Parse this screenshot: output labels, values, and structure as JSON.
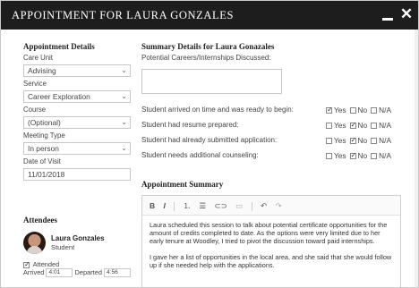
{
  "window": {
    "title": "APPOINTMENT FOR LAURA GONZALES"
  },
  "details": {
    "heading": "Appointment Details",
    "care_unit": {
      "label": "Care Unit",
      "value": "Advising"
    },
    "service": {
      "label": "Service",
      "value": "Career Exploration"
    },
    "course": {
      "label": "Course",
      "value": "(Optional)"
    },
    "meeting_type": {
      "label": "Meeting Type",
      "value": "In person"
    },
    "date": {
      "label": "Date of Visit",
      "value": "11/01/2018"
    }
  },
  "attendees": {
    "heading": "Attendees",
    "name": "Laura Gonzales",
    "role": "Student",
    "attended_label": "Attended",
    "attended": true,
    "arrived_label": "Arrived",
    "arrived": "4:01",
    "departed_label": "Departed",
    "departed": "4:56"
  },
  "summary": {
    "heading": "Summary Details for Laura Gonazales",
    "careers_label": "Potential Careers/Internships Discussed:",
    "questions": [
      {
        "text": "Student arrived on time and was ready to begin:",
        "answer": "Yes"
      },
      {
        "text": "Student had resume prepared:",
        "answer": "No"
      },
      {
        "text": "Student had already submitted application:",
        "answer": "No"
      },
      {
        "text": "Student needs additional counseling:",
        "answer": "No"
      }
    ],
    "options": [
      "Yes",
      "No",
      "N/A"
    ]
  },
  "appointment_summary": {
    "heading": "Appointment Summary",
    "toolbar": {
      "bold": "B",
      "italic": "I",
      "ordered_list": "⒈",
      "bullet_list": "☰",
      "link": "⊂⊃",
      "image": "▭",
      "undo": "↶",
      "redo": "↷"
    },
    "paragraphs": [
      "Laura scheduled this session to talk about potential certificate opportunities for the amount of credits completed to date.  As the options were very limited due to her early tenure at Woodley, I tried to pivot the discussion toward paid internships.",
      "I gave her a list of opportunities in the local area, and she said that she would follow up if she needed help with the applications."
    ]
  }
}
